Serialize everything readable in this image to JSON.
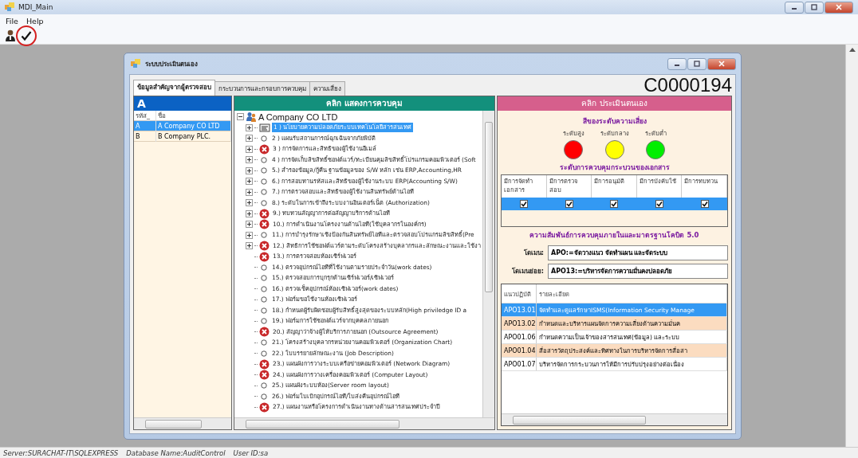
{
  "window": {
    "title": "MDI_Main"
  },
  "menu": [
    "File",
    "Help"
  ],
  "toolbar": [
    {
      "kind": "user",
      "circled": false
    },
    {
      "kind": "check",
      "circled": true
    }
  ],
  "child_window": {
    "title": "ระบบประเมินตนเอง",
    "code": "C0000194",
    "tabs": [
      {
        "label": "ข้อมูลสำคัญจากผู้ตรวจสอบ",
        "selected": true
      },
      {
        "label": "กระบวนการและกรอบการควบคุม",
        "selected": false
      },
      {
        "label": "ความเสี่ยง",
        "selected": false
      }
    ],
    "company_panel": {
      "header": "A",
      "columns": [
        "รหัส_",
        "ชื่อ"
      ],
      "rows": [
        {
          "code": "A",
          "name": "A Company CO LTD",
          "selected": true
        },
        {
          "code": "B",
          "name": "B Company PLC.",
          "selected": false
        }
      ]
    },
    "control_panel": {
      "header": "คลิก แสดงการควบคุม",
      "root": "A Company CO LTD",
      "items": [
        {
          "label": "1 )  นโยบายความปลอดภัยระบบเทคโนโลยีสารสนเทศ",
          "kind": "document",
          "expandable": true,
          "selected": true
        },
        {
          "label": "2 )  แผนรับสถานการณ์ฉุกเฉินจากภัยพิบัติ",
          "kind": "open",
          "expandable": true,
          "selected": false
        },
        {
          "label": "3 )  การจัดการและสิทธิของผู้ใช้งานอีเมล์",
          "kind": "fail",
          "expandable": true,
          "selected": false
        },
        {
          "label": "4 )  การจัดเก็บลิขสิทธิ์ซอฟต์แวร์/ทะเบียนคุมลิขสิทธิ์โปรแกรมคอมพิวเตอร์ (Soft",
          "kind": "open",
          "expandable": true,
          "selected": false
        },
        {
          "label": "5.)  สำรองข้อมูล/กู้คืน ฐานข้อมูลของ S/W หลัก เช่น ERP,Accounting,HR",
          "kind": "open",
          "expandable": true,
          "selected": false
        },
        {
          "label": "6.)  การสอบทานรหัสและสิทธิของผู้ใช้งานระบบ ERP(Accounting S/W)",
          "kind": "open",
          "expandable": true,
          "selected": false
        },
        {
          "label": "7.)  การตรวจสอบและสิทธิของผู้ใช้งานสินทรัพย์ด้านไอที",
          "kind": "open",
          "expandable": true,
          "selected": false
        },
        {
          "label": "8.)  ระดับในการเข้าถึงระบบงานอินเตอร์เน็ต (Authorization)",
          "kind": "open",
          "expandable": true,
          "selected": false
        },
        {
          "label": "9.)  ทบทวนสัญญาการต่อสัญญาบริการด้านไอที",
          "kind": "fail",
          "expandable": true,
          "selected": false
        },
        {
          "label": "10.)  การดำเนินงานโครงงานด้านไอที(ใช้บุคลากรในองค์กร)",
          "kind": "fail",
          "expandable": true,
          "selected": false
        },
        {
          "label": "11.)  การบำรุงรักษาเชิงป้องกันสินทรัพย์ไอทีและตรวจสอบโปรแกรมลิขสิทธิ์(Pre",
          "kind": "open",
          "expandable": true,
          "selected": false
        },
        {
          "label": "12.)  สิทธิการใช้ซอฟต์แวร์ตามระดับโครงสร้างบุคลากรและลักษณะงานและใช้งา",
          "kind": "fail",
          "expandable": true,
          "selected": false
        },
        {
          "label": "13.)  การตรวจสอบห้องเซิร์ฟเวอร์",
          "kind": "fail",
          "expandable": false,
          "selected": false
        },
        {
          "label": "14.)  ตรวจอุปกรณ์ไอทีที่ใช้งานตามรายประจำวัน(work dates)",
          "kind": "open",
          "expandable": false,
          "selected": false
        },
        {
          "label": "15.)  ตรวจสอบการบุกรุกด้านเซิร์ฟเวอร์/เซิฟเวอร์",
          "kind": "open",
          "expandable": false,
          "selected": false
        },
        {
          "label": "16.)  ตรวจเช็คอุปกรณ์ห้องเซิฟเวอร์(work dates)",
          "kind": "open",
          "expandable": false,
          "selected": false
        },
        {
          "label": "17.)  ฟอร์มขอใช้งานห้องเซิฟเวอร์",
          "kind": "open",
          "expandable": false,
          "selected": false
        },
        {
          "label": "18.)  กำหนดผู้รับผิดชอบผู้รับสิทธิ์สูงสุดของระบบหลัก(High priviledge ID a",
          "kind": "open",
          "expandable": false,
          "selected": false
        },
        {
          "label": "19.)  ฟอร์มการใช้ซอฟต์แวร์จากบุคคลภายนอก",
          "kind": "open",
          "expandable": false,
          "selected": false
        },
        {
          "label": "20.)  สัญญาว่าจ้างผู้ให้บริการภายนอก (Outsource Agreement)",
          "kind": "fail",
          "expandable": false,
          "selected": false
        },
        {
          "label": "21.)  โครงสร้างบุคลากรหน่วยงานคอมพิวเตอร์ (Organization Chart)",
          "kind": "open",
          "expandable": false,
          "selected": false
        },
        {
          "label": "22.)  ใบบรรยายลักษณะงาน (Job Description)",
          "kind": "open",
          "expandable": false,
          "selected": false
        },
        {
          "label": "23.)  แผนผังการวางระบบเครือข่ายคอมพิวเตอร์ (Network Diagram)",
          "kind": "fail",
          "expandable": false,
          "selected": false
        },
        {
          "label": "24.)  แผนผังการวางเครื่องคอมพิวเตอร์ (Computer Layout)",
          "kind": "fail",
          "expandable": false,
          "selected": false
        },
        {
          "label": "25.)  แผนผังระบบห้อง(Server room layout)",
          "kind": "open",
          "expandable": false,
          "selected": false
        },
        {
          "label": "26.)  ฟอร์มใบเบิกอุปกรณ์ไอที/ใบส่งคืนอุปกรณ์ไอที",
          "kind": "open",
          "expandable": false,
          "selected": false
        },
        {
          "label": "27.)  แผนงานหรือโครงการดำเนินงานทางด้านสารสนเทศประจำปี",
          "kind": "fail",
          "expandable": false,
          "selected": false
        }
      ]
    },
    "assessment_panel": {
      "header": "คลิก ประเมินตนเอง",
      "risk_title": "สีของระดับความเสี่ยง",
      "risk_levels": [
        {
          "label": "ระดับสูง",
          "color": "#ff0000"
        },
        {
          "label": "ระดับกลาง",
          "color": "#ffff00"
        },
        {
          "label": "ระดับต่ำ",
          "color": "#00ee00"
        }
      ],
      "doc_title": "ระดับการควบคุมกระบวนของเอกสาร",
      "doc_columns": [
        "มีการจัดทำเอกสาร",
        "มีการตรวจสอบ",
        "มีการอนุมัติ",
        "มีการบังคับใช้",
        "มีการทบทวน"
      ],
      "doc_row": {
        "selected": true,
        "cells": [
          {
            "checked": true
          },
          {
            "checked": true
          },
          {
            "checked": true
          },
          {
            "checked": true
          },
          {
            "checked": true
          }
        ]
      },
      "cobit_title": "ความสัมพันธ์การควบคุมภายในและมาตรฐานโคบิต 5.0",
      "domain": {
        "label": "โดเมน:",
        "value": "APO:=จัดวางแนว จัดทำแผน และจัดระบบ"
      },
      "subdomain": {
        "label": "โดเมนย่อย:",
        "value": "APO13:=บริหารจัดการความมั่นคงปลอดภัย"
      },
      "practices": {
        "columns": [
          "แนวปฏิบัติ",
          "รายละเอียด"
        ],
        "rows": [
          {
            "code": "APO13.01",
            "detail": "จัดทำและดูแลรักษาISMS(Information Security Manage",
            "selected": true
          },
          {
            "code": "APO13.02",
            "detail": "กำหนดและบริหารแผนจัดการความเสี่ยงด้านความมั่นค",
            "selected": false
          },
          {
            "code": "APO01.06",
            "detail": "กำหนดความเป็นเจ้าของสารสนเทศ(ข้อมูล) และระบบ",
            "selected": false
          },
          {
            "code": "APO01.04",
            "detail": "สื่อสารวัตถุประสงค์และทิศทางในการบริหารจัดการสื่อสา",
            "selected": false
          },
          {
            "code": "APO01.07",
            "detail": "บริหารจัดการกระบวนการให้มีการปรับปรุงอย่างต่อเนื่อง",
            "selected": false
          }
        ]
      }
    }
  },
  "status_bar": [
    "Server:SURACHAT-IT\\SQLEXPRESS",
    "Database Name:AuditControl",
    "User ID:sa"
  ]
}
